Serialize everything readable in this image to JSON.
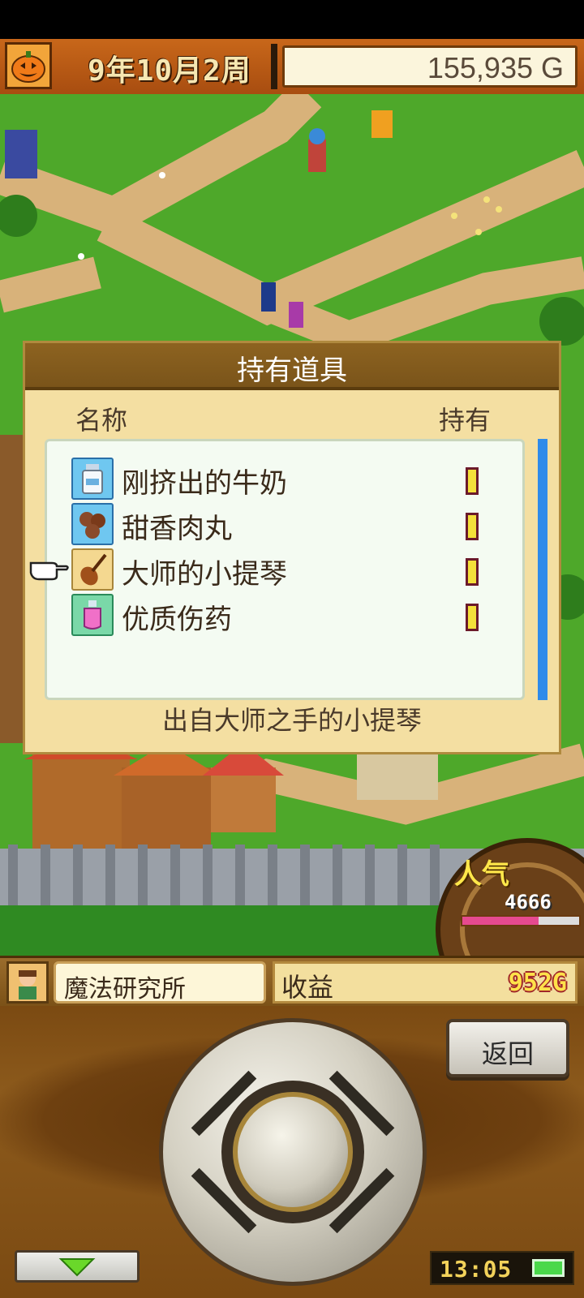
{
  "header": {
    "date": "9年10月2周",
    "gold": "155,935 G"
  },
  "dialog": {
    "title": "持有道具",
    "col_name": "名称",
    "col_held": "持有",
    "items": [
      {
        "label": "刚挤出的牛奶",
        "icon": "milk-bottle-icon"
      },
      {
        "label": "甜香肉丸",
        "icon": "meatball-icon"
      },
      {
        "label": "大师的小提琴",
        "icon": "violin-icon"
      },
      {
        "label": "优质伤药",
        "icon": "potion-icon"
      }
    ],
    "description": "出自大师之手的小提琴"
  },
  "popularity": {
    "label": "人气",
    "value": "4666",
    "fill_fraction": 0.65
  },
  "infobar": {
    "facility_name": "魔法研究所",
    "income_label": "收益",
    "income_value": "952G"
  },
  "controls": {
    "back_label": "返回",
    "clock": "13:05"
  },
  "colors": {
    "grass": "#4ea82a",
    "path": "#d8b27a",
    "dialog_bg": "#f4dfa2",
    "title_bar": "#8d6320",
    "scrollbar": "#2f8bea",
    "popularity_fill": "#e64a8f"
  }
}
